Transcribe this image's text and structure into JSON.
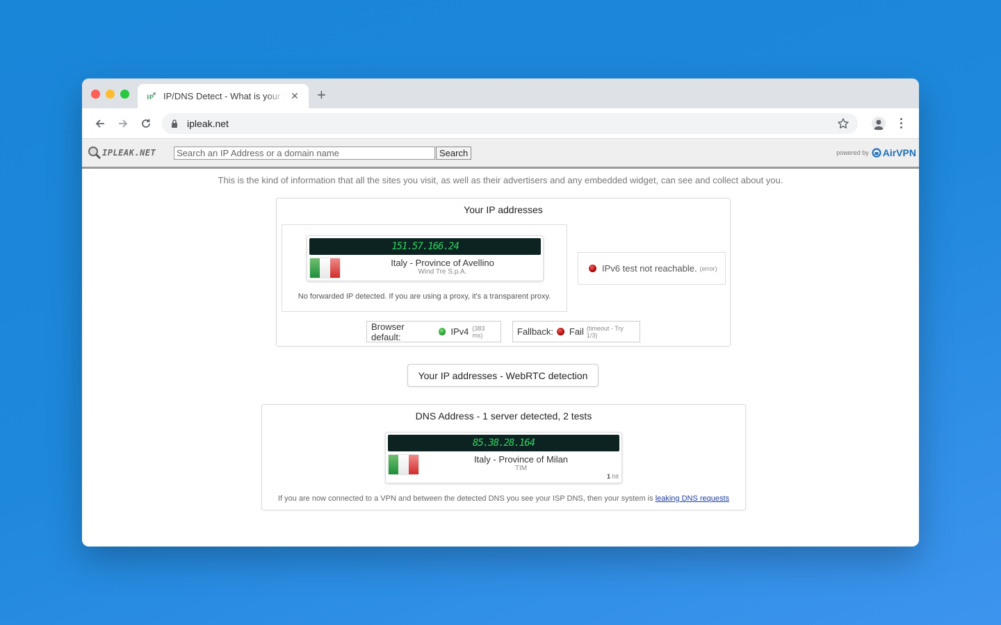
{
  "browser": {
    "tab_title": "IP/DNS Detect - What is your IP",
    "url": "ipleak.net"
  },
  "site": {
    "logo_text": "IPLEAK.NET",
    "search_placeholder": "Search an IP Address or a domain name",
    "search_button": "Search",
    "powered_by": "powered by",
    "sponsor": "AirVPN",
    "intro": "This is the kind of information that all the sites you visit, as well as their advertisers and any embedded widget, can see and collect about you."
  },
  "ip_panel": {
    "title": "Your IP addresses",
    "ipv4": {
      "address": "151.57.166.24",
      "location": "Italy - Province of Avellino",
      "isp": "Wind Tre S.p.A."
    },
    "forwarded_note": "No forwarded IP detected. If you are using a proxy, it's a transparent proxy.",
    "ipv6": {
      "text": "IPv6 test not reachable.",
      "detail": "(error)",
      "status_color": "#c00000"
    },
    "browser_default": {
      "label": "Browser default:",
      "value": "IPv4",
      "detail": "(383 ms)",
      "status_color": "#1b9b2b"
    },
    "fallback": {
      "label": "Fallback:",
      "value": "Fail",
      "detail": "(timeout - Try 1/3)",
      "status_color": "#c00000"
    }
  },
  "webrtc": {
    "button_label": "Your IP addresses - WebRTC detection"
  },
  "dns_panel": {
    "title": "DNS Address - 1 server detected, 2 tests",
    "server": {
      "address": "85.38.28.164",
      "location": "Italy - Province of Milan",
      "isp": "TIM",
      "hits": "1",
      "hits_label": "hit"
    },
    "note_prefix": "If you are now connected to a VPN and between the detected DNS you see your ISP DNS, then your system is",
    "note_link": "leaking DNS requests"
  },
  "colors": {
    "ip_screen_bg": "#0c2321",
    "ip_screen_text": "#2fd460",
    "flag": [
      "#1d8f3a",
      "#ffffff",
      "#d22c2c"
    ]
  }
}
